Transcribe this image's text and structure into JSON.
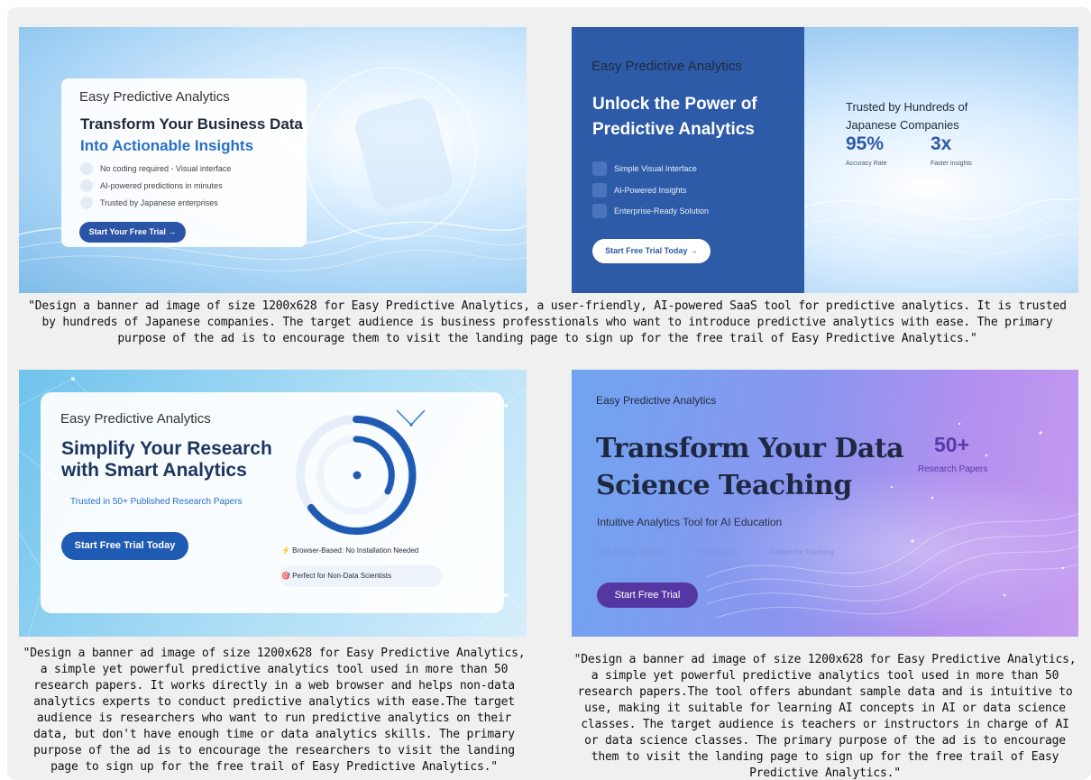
{
  "banner1": {
    "brand": "Easy Predictive Analytics",
    "headline_line1": "Transform Your Business Data",
    "headline_line2": "Into Actionable Insights",
    "features": [
      "No coding required - Visual interface",
      "AI-powered predictions in minutes",
      "Trusted by Japanese enterprises"
    ],
    "cta": "Start Your Free Trial →"
  },
  "caption1": "\"Design a banner ad image of size 1200x628 for Easy Predictive Analytics, a user-friendly, AI-powered SaaS tool for predictive analytics. It is trusted by hundreds of Japanese companies. The target audience is business professtionals who want to introduce predictive analytics with ease. The primary purpose of the ad is to encourage them to visit the landing page to sign up for the free trail of Easy Predictive Analytics.\"",
  "banner2": {
    "brand": "Easy Predictive Analytics",
    "headline_line1": "Unlock the Power of",
    "headline_line2": "Predictive Analytics",
    "features": [
      "Simple Visual Interface",
      "AI-Powered Insights",
      "Enterprise-Ready Solution"
    ],
    "cta": "Start Free Trial Today →",
    "trust_line1": "Trusted by Hundreds of",
    "trust_line2": "Japanese Companies",
    "stat1_value": "95%",
    "stat1_label": "Accuracy Rate",
    "stat2_value": "3x",
    "stat2_label": "Faster Insights"
  },
  "banner3": {
    "brand": "Easy Predictive Analytics",
    "headline_line1": "Simplify Your Research",
    "headline_line2": "with Smart Analytics",
    "subtitle": "Trusted in 50+ Published Research Papers",
    "cta": "Start Free Trial Today",
    "pill1": "⚡ Browser-Based: No Installation Needed",
    "pill2": "🎯 Perfect for Non-Data Scientists",
    "accent": "#1f5bb3"
  },
  "caption3": "\"Design a banner ad image of size 1200x628 for Easy Predictive Analytics, a simple yet powerful predictive analytics tool used in more than 50 research papers. It works directly in a web browser and helps non-data analytics experts to conduct predictive analytics with ease.The target audience is researchers who want to run predictive analytics on their data, but don't have enough time or data analytics skills. The primary purpose of the ad is to encourage the researchers to visit the landing page to sign up for the free trail of Easy Predictive Analytics.\"",
  "banner4": {
    "brand": "Easy Predictive Analytics",
    "headline_line1": "Transform Your Data",
    "headline_line2": "Science Teaching",
    "subtitle": "Intuitive Analytics Tool for AI Education",
    "features": [
      "Rich Sample Datasets",
      "•",
      "Easy to Use",
      "•",
      "Perfect for Teaching"
    ],
    "cta": "Start Free Trial",
    "stat_value": "50+",
    "stat_label": "Research Papers"
  },
  "caption4": "\"Design a banner ad image of size 1200x628 for Easy Predictive Analytics, a simple yet powerful predictive analytics tool used in more than 50 research papers.The tool offers abundant sample data and is intuitive to use, making it suitable for learning AI concepts in AI or data science classes. The target audience is teachers or instructors in charge of AI or data science classes. The primary purpose of the ad is to encourage them to visit the landing page to sign up for the free trail of Easy Predictive Analytics.\""
}
